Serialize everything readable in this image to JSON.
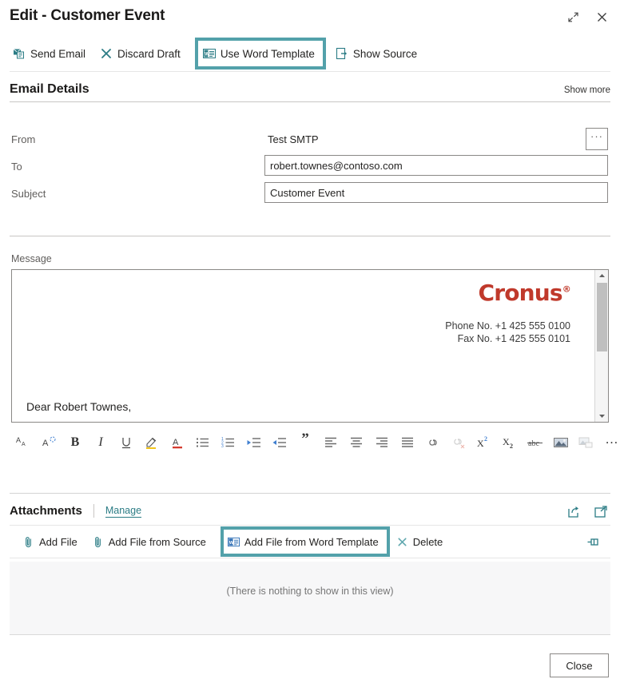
{
  "window": {
    "title": "Edit - Customer Event",
    "expand_icon": "expand-icon",
    "close_icon": "close-icon"
  },
  "actionbar": {
    "items": [
      {
        "label": "Send Email",
        "icon": "send-email-icon",
        "highlighted": false
      },
      {
        "label": "Discard Draft",
        "icon": "discard-x-icon",
        "highlighted": false
      },
      {
        "label": "Use Word Template",
        "icon": "word-template-icon",
        "highlighted": true
      },
      {
        "label": "Show Source",
        "icon": "show-source-icon",
        "highlighted": false
      }
    ]
  },
  "email_details": {
    "section_title": "Email Details",
    "show_more": "Show more",
    "fields": {
      "from": {
        "label": "From",
        "value": "Test SMTP",
        "ellipsis": "···"
      },
      "to": {
        "label": "To",
        "value": "robert.townes@contoso.com",
        "placeholder": ""
      },
      "subject": {
        "label": "Subject",
        "value": "Customer Event",
        "placeholder": ""
      }
    }
  },
  "message": {
    "label": "Message",
    "logo_text": "Cronus",
    "logo_mark": "®",
    "logo_color": "#c0392b",
    "phone": "Phone No. +1 425 555 0100",
    "fax": "Fax No. +1 425 555 0101",
    "greeting": "Dear Robert Townes,",
    "scroll_up_icon": "scroll-up-arrow-icon",
    "scroll_down_icon": "scroll-down-arrow-icon"
  },
  "richtext_toolbar": {
    "buttons": [
      {
        "name": "font-size-icon",
        "label": "AA"
      },
      {
        "name": "clear-formatting-icon",
        "label": "A"
      },
      {
        "name": "bold-icon",
        "label": "B"
      },
      {
        "name": "italic-icon",
        "label": "I"
      },
      {
        "name": "underline-icon",
        "label": "U"
      },
      {
        "name": "highlight-color-icon",
        "label": "Highlight"
      },
      {
        "name": "font-color-icon",
        "label": "A"
      },
      {
        "name": "bulleted-list-icon",
        "label": "Bulleted list"
      },
      {
        "name": "numbered-list-icon",
        "label": "Numbered list"
      },
      {
        "name": "decrease-indent-icon",
        "label": "Decrease indent"
      },
      {
        "name": "increase-indent-icon",
        "label": "Increase indent"
      },
      {
        "name": "blockquote-icon",
        "label": "”"
      },
      {
        "name": "align-left-icon",
        "label": "Align left"
      },
      {
        "name": "align-center-icon",
        "label": "Align center"
      },
      {
        "name": "align-right-icon",
        "label": "Align right"
      },
      {
        "name": "align-justify-icon",
        "label": "Justify"
      },
      {
        "name": "insert-link-icon",
        "label": "Insert link"
      },
      {
        "name": "remove-link-icon",
        "label": "Remove link"
      },
      {
        "name": "superscript-icon",
        "label": "X2"
      },
      {
        "name": "subscript-icon",
        "label": "X2"
      },
      {
        "name": "strikethrough-icon",
        "label": "abc"
      },
      {
        "name": "insert-image-icon",
        "label": "Insert image"
      },
      {
        "name": "image-options-icon",
        "label": "Image options"
      },
      {
        "name": "more-options-icon",
        "label": "…"
      }
    ]
  },
  "attachments": {
    "title": "Attachments",
    "manage": "Manage",
    "share_icon": "share-icon",
    "open-full-icon": "open-in-new-window-icon",
    "pin_icon": "pin-icon",
    "actions": [
      {
        "label": "Add File",
        "icon": "paperclip-icon",
        "highlighted": false
      },
      {
        "label": "Add File from Source",
        "icon": "paperclip-icon",
        "highlighted": false
      },
      {
        "label": "Add File from Word Template",
        "icon": "word-icon",
        "highlighted": true
      },
      {
        "label": "Delete",
        "icon": "delete-x-icon",
        "highlighted": false
      }
    ],
    "empty_message": "(There is nothing to show in this view)"
  },
  "footer": {
    "close_label": "Close"
  },
  "colors": {
    "accent_teal": "#2b7c85",
    "highlight_teal": "#53a1aa",
    "logo_red": "#c0392b",
    "border_grey": "#8a8886"
  }
}
